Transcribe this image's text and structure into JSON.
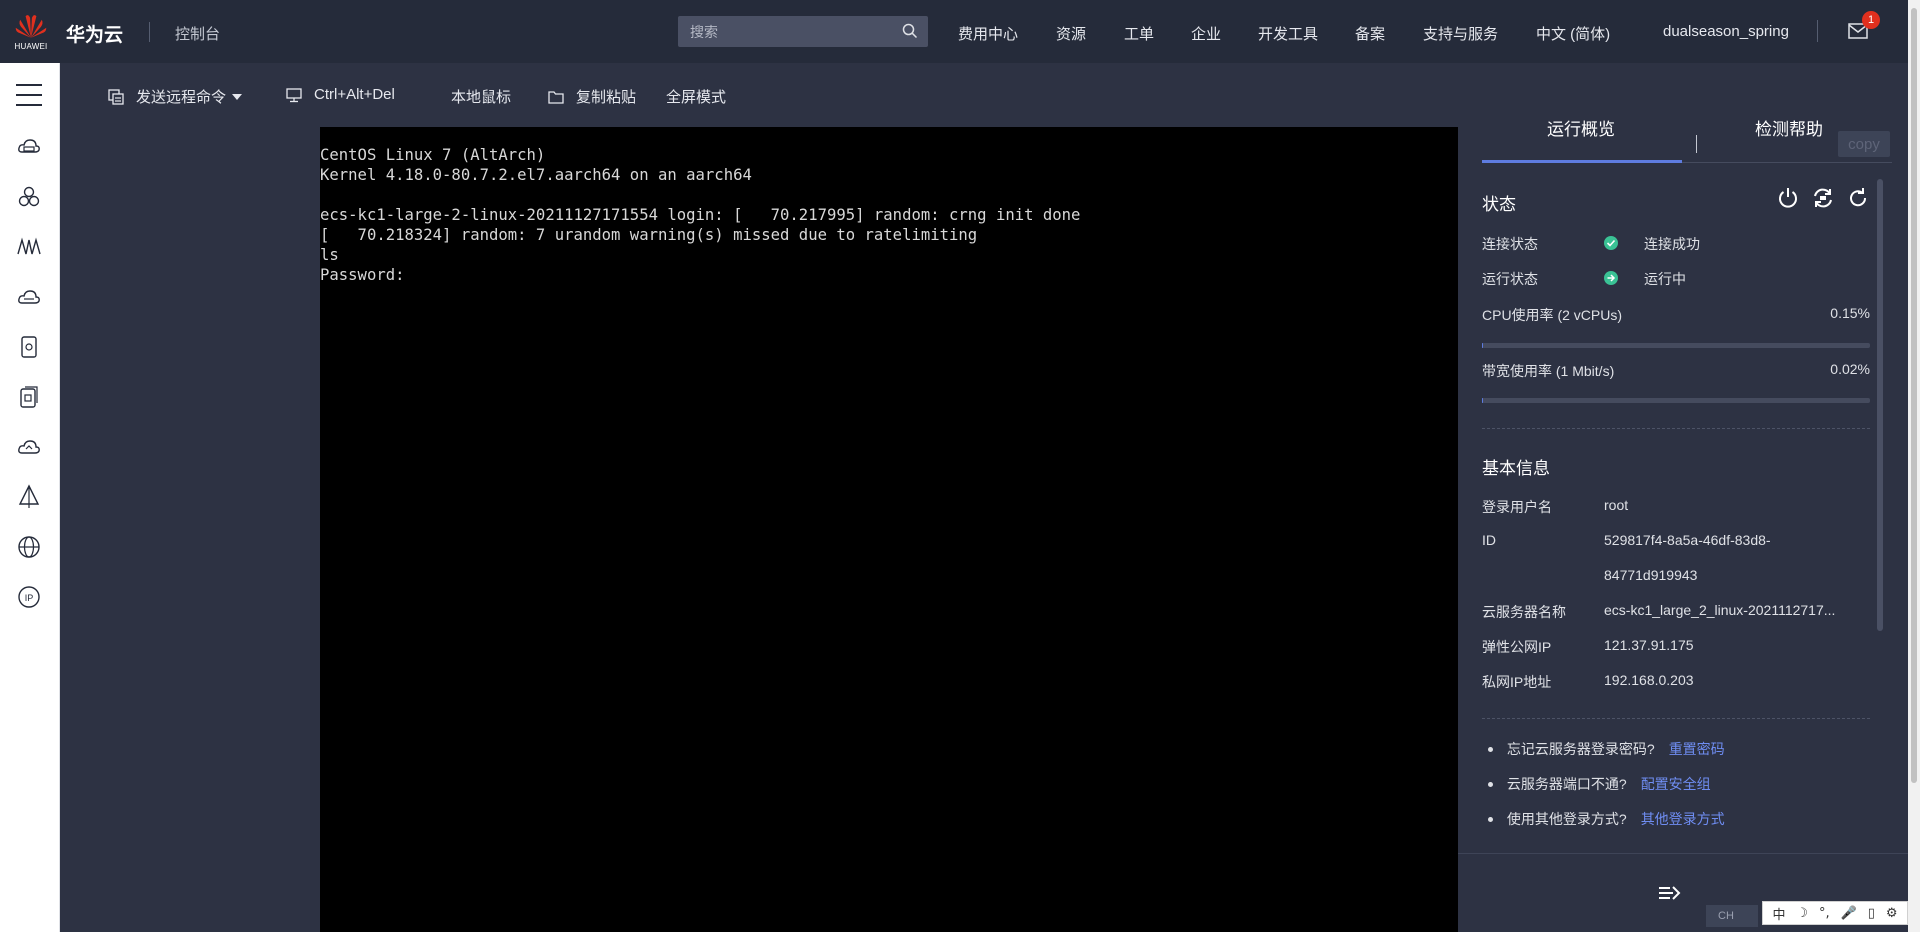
{
  "header": {
    "logo_text": "HUAWEI",
    "brand": "华为云",
    "console": "控制台",
    "search_placeholder": "搜索",
    "nav": [
      "费用中心",
      "资源",
      "工单",
      "企业",
      "开发工具",
      "备案",
      "支持与服务",
      "中文 (简体)",
      "dualseason_spring"
    ],
    "mail_badge": "1"
  },
  "sidebar": {
    "icons": [
      "cloud-server-icon",
      "cluster-icon",
      "network-icon",
      "cloud-storage-icon",
      "database-icon",
      "backup-icon",
      "cloud-upload-icon",
      "deploy-icon",
      "globe-icon",
      "ip-icon"
    ]
  },
  "toolbar": {
    "send_command": "发送远程命令",
    "ctrl_alt_del": "Ctrl+Alt+Del",
    "local_mouse": "本地鼠标",
    "copy_paste": "复制粘贴",
    "fullscreen": "全屏模式"
  },
  "terminal": {
    "lines": [
      "CentOS Linux 7 (AltArch)",
      "Kernel 4.18.0-80.7.2.el7.aarch64 on an aarch64",
      "",
      "ecs-kc1-large-2-linux-20211127171554 login: [   70.217995] random: crng init done",
      "[   70.218324] random: 7 urandom warning(s) missed due to ratelimiting",
      "ls",
      "Password:"
    ]
  },
  "panel": {
    "tabs": [
      "运行概览",
      "检测帮助"
    ],
    "copy_label": "copy",
    "status_title": "状态",
    "connection_label": "连接状态",
    "connection_value": "连接成功",
    "running_label": "运行状态",
    "running_value": "运行中",
    "cpu_label": "CPU使用率 (2 vCPUs)",
    "cpu_value": "0.15%",
    "cpu_fraction": 0.0015,
    "bandwidth_label": "带宽使用率 (1 Mbit/s)",
    "bandwidth_value": "0.02%",
    "bandwidth_fraction": 0.0002,
    "basic_title": "基本信息",
    "info": [
      {
        "label": "登录用户名",
        "value": "root"
      },
      {
        "label": "ID",
        "value": "529817f4-8a5a-46df-83d8-"
      },
      {
        "label": "",
        "value": "84771d919943"
      },
      {
        "label": "云服务器名称",
        "value": "ecs-kc1_large_2_linux-2021112717..."
      },
      {
        "label": "弹性公网IP",
        "value": "121.37.91.175"
      },
      {
        "label": "私网IP地址",
        "value": "192.168.0.203"
      }
    ],
    "help": [
      {
        "q": "忘记云服务器登录密码?",
        "link": "重置密码"
      },
      {
        "q": "云服务器端口不通?",
        "link": "配置安全组"
      },
      {
        "q": "使用其他登录方式?",
        "link": "其他登录方式"
      }
    ]
  },
  "ime": {
    "ch_label": "CH",
    "chars": [
      "中",
      "☽",
      "°,",
      "🎤",
      "▯",
      "⚙"
    ]
  },
  "colors": {
    "topbar": "#252b3a",
    "toolbar": "#2d3243",
    "accent": "#5e7ce0",
    "ok": "#3ac295",
    "link": "#6f8df2"
  }
}
